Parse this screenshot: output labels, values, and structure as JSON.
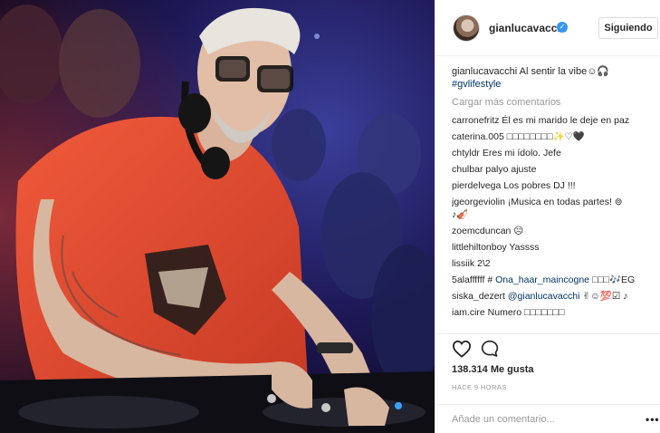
{
  "post": {
    "author": "gianlucavacchi",
    "follow_label": "Siguiendo",
    "caption_user": "gianlucavacchi",
    "caption_text": " Al sentir la vibe☺🎧",
    "caption_hashtag": "#gvlifestyle",
    "load_more": "Cargar más comentarios",
    "comments": [
      {
        "user": "carronefritz",
        "text": " Él es mi marido le deje en paz"
      },
      {
        "user": "caterina.005",
        "text": " □□□□□□□□✨♡🖤"
      },
      {
        "user": "chtyldr",
        "text": " Eres mi ídolo. Jefe"
      },
      {
        "user": "chulbar",
        "text": " palyo ajuste"
      },
      {
        "user": "pierdelvega",
        "text": " Los pobres DJ !!!"
      },
      {
        "user": "jgeorgeviolin",
        "text": " ¡Musica en todas partes! ⊚"
      },
      {
        "user": "",
        "text": "♪🎻"
      },
      {
        "user": "zoemcduncan",
        "text": " ☹"
      },
      {
        "user": "littlehiltonboy",
        "text": " Yassss"
      },
      {
        "user": "lissiik",
        "text": " 2\\2"
      },
      {
        "user": "5alaffffff",
        "text": " # ",
        "mention": "Ona_haar_maincogne",
        "tail": " □□□🎶EG"
      },
      {
        "user": "siska_dezert",
        "text": " ",
        "mention": "@gianlucavacchi",
        "tail": " ✌☺💯☑ ♪"
      },
      {
        "user": "iam.cire",
        "text": " Numero □□□□□□□"
      }
    ],
    "likes": "138.314 Me gusta",
    "time": "HACE 9 HORAS",
    "add_comment_placeholder": "Añade un comentario...",
    "more_label": "•••"
  },
  "icons": {
    "verified": "verified-badge-icon",
    "heart": "heart-icon",
    "comment": "comment-bubble-icon",
    "more": "more-options-icon"
  },
  "colors": {
    "verified": "#3897f0",
    "link": "#003569",
    "muted": "#999999",
    "shirt": "#e0472f"
  }
}
